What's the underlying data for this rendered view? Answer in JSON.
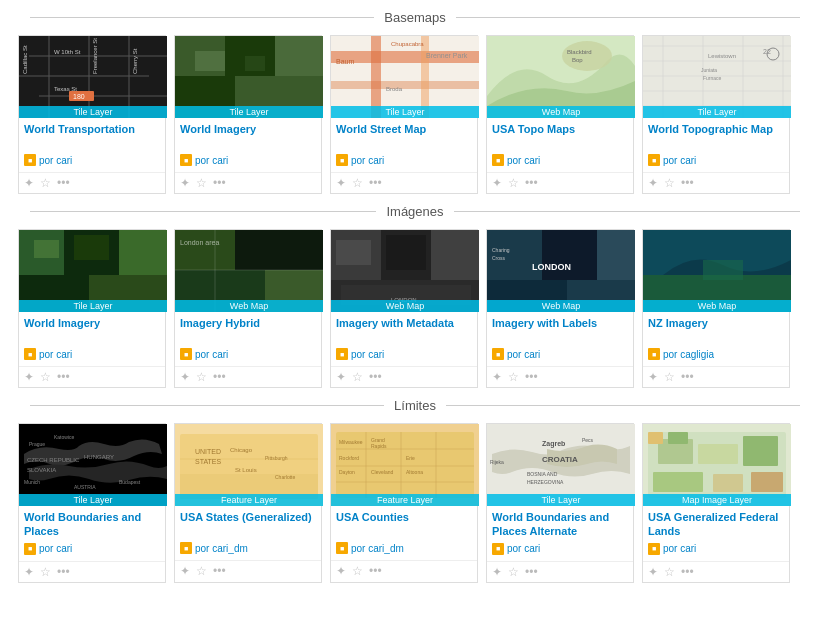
{
  "sections": [
    {
      "id": "basemaps",
      "title": "Basemaps",
      "cards": [
        {
          "id": "world-transportation",
          "title": "World Transportation",
          "badge": "Tile Layer",
          "owner": "cari",
          "thumb_class": "thumb-transport"
        },
        {
          "id": "world-imagery",
          "title": "World Imagery",
          "badge": "Tile Layer",
          "owner": "cari",
          "thumb_class": "thumb-imagery"
        },
        {
          "id": "world-street-map",
          "title": "World Street Map",
          "badge": "Tile Layer",
          "owner": "cari",
          "thumb_class": "thumb-street"
        },
        {
          "id": "usa-topo-maps",
          "title": "USA Topo Maps",
          "badge": "Web Map",
          "owner": "cari",
          "thumb_class": "thumb-topo"
        },
        {
          "id": "world-topographic-map",
          "title": "World Topographic Map",
          "badge": "Tile Layer",
          "owner": "cari",
          "thumb_class": "thumb-topo2"
        }
      ]
    },
    {
      "id": "imagenes",
      "title": "Imágenes",
      "cards": [
        {
          "id": "world-imagery2",
          "title": "World Imagery",
          "badge": "Tile Layer",
          "owner": "cari",
          "thumb_class": "thumb-imagery2"
        },
        {
          "id": "imagery-hybrid",
          "title": "Imagery Hybrid",
          "badge": "Web Map",
          "owner": "cari",
          "thumb_class": "thumb-hybrid"
        },
        {
          "id": "imagery-metadata",
          "title": "Imagery with Metadata",
          "badge": "Web Map",
          "owner": "cari",
          "thumb_class": "thumb-metadata"
        },
        {
          "id": "imagery-labels",
          "title": "Imagery with Labels",
          "badge": "Web Map",
          "owner": "cari",
          "thumb_class": "thumb-labels"
        },
        {
          "id": "nz-imagery",
          "title": "NZ Imagery",
          "badge": "Web Map",
          "owner": "cagligia",
          "thumb_class": "thumb-nz"
        }
      ]
    },
    {
      "id": "limites",
      "title": "Límites",
      "cards": [
        {
          "id": "world-boundaries-places",
          "title": "World Boundaries and Places",
          "badge": "Tile Layer",
          "owner": "cari",
          "thumb_class": "thumb-boundaries"
        },
        {
          "id": "usa-states",
          "title": "USA States (Generalized)",
          "badge": "Feature Layer",
          "owner": "cari_dm",
          "thumb_class": "thumb-states"
        },
        {
          "id": "usa-counties",
          "title": "USA Counties",
          "badge": "Feature Layer",
          "owner": "cari_dm",
          "thumb_class": "thumb-counties"
        },
        {
          "id": "world-boundaries-alternate",
          "title": "World Boundaries and Places Alternate",
          "badge": "Tile Layer",
          "owner": "cari",
          "thumb_class": "thumb-boundaries2"
        },
        {
          "id": "usa-federal-lands",
          "title": "USA Generalized Federal Lands",
          "badge": "Map Image Layer",
          "owner": "cari",
          "thumb_class": "thumb-federal"
        }
      ]
    }
  ],
  "icons": {
    "owner": "■",
    "add": "✦",
    "star": "☆",
    "more": "•••"
  }
}
